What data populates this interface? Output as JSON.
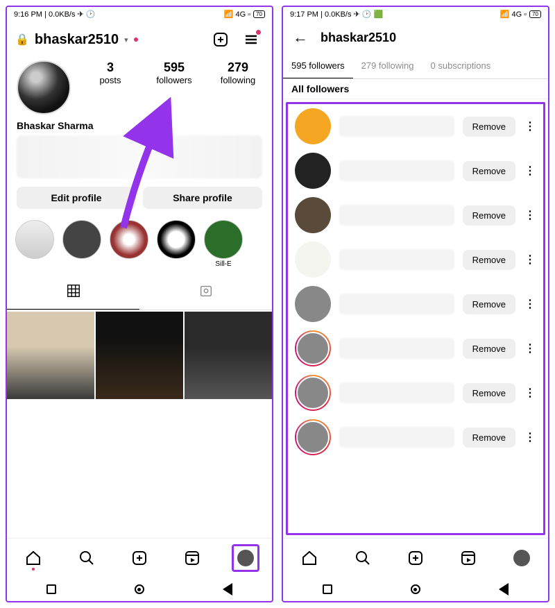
{
  "left": {
    "status": {
      "time": "9:16 PM",
      "net": "0.0KB/s",
      "battery": "70"
    },
    "header": {
      "username": "bhaskar2510"
    },
    "stats": {
      "posts": {
        "n": "3",
        "l": "posts"
      },
      "followers": {
        "n": "595",
        "l": "followers"
      },
      "following": {
        "n": "279",
        "l": "following"
      }
    },
    "display_name": "Bhaskar Sharma",
    "buttons": {
      "edit": "Edit profile",
      "share": "Share profile"
    },
    "highlights": [
      {
        "label": ""
      },
      {
        "label": ""
      },
      {
        "label": ""
      },
      {
        "label": ""
      },
      {
        "label": "Sill-E"
      }
    ]
  },
  "right": {
    "status": {
      "time": "9:17 PM",
      "net": "0.0KB/s",
      "battery": "70"
    },
    "header": {
      "username": "bhaskar2510"
    },
    "tabs": {
      "followers": "595 followers",
      "following": "279 following",
      "subs": "0 subscriptions"
    },
    "section": "All followers",
    "rows": [
      {
        "remove": "Remove",
        "story": false
      },
      {
        "remove": "Remove",
        "story": false
      },
      {
        "remove": "Remove",
        "story": false
      },
      {
        "remove": "Remove",
        "story": false
      },
      {
        "remove": "Remove",
        "story": false
      },
      {
        "remove": "Remove",
        "story": true
      },
      {
        "remove": "Remove",
        "story": true
      },
      {
        "remove": "Remove",
        "story": true
      }
    ]
  }
}
